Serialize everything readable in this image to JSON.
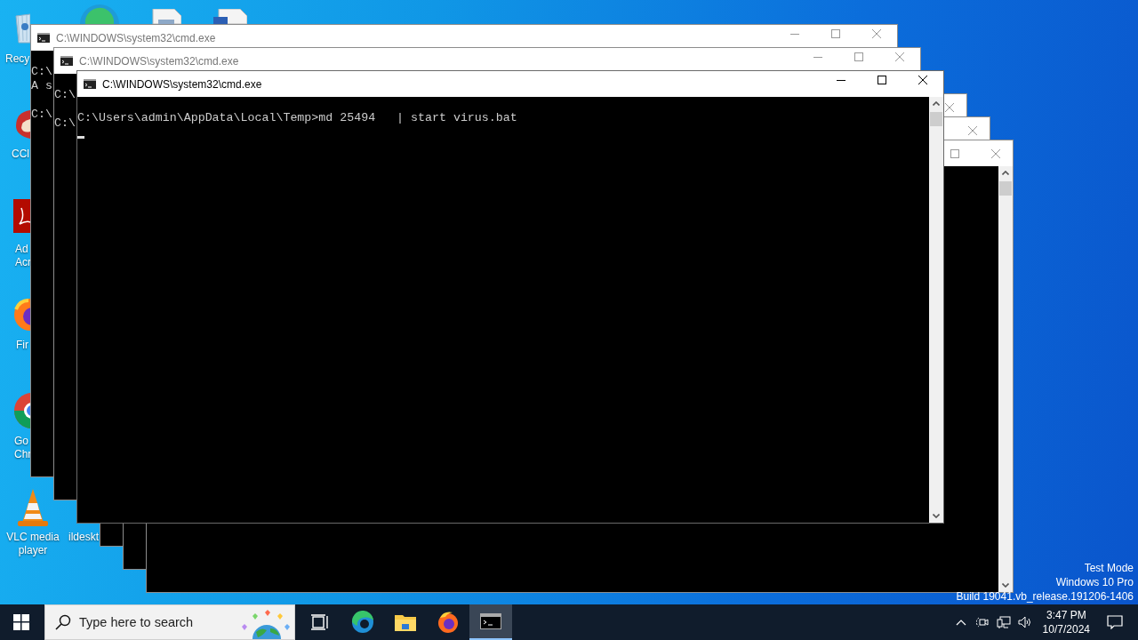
{
  "desktop_icons": [
    {
      "label": [
        "Recy"
      ]
    },
    {
      "label": [
        "CCl"
      ]
    },
    {
      "label": [
        "Ad",
        "Acr"
      ]
    },
    {
      "label": [
        "Fir"
      ]
    },
    {
      "label": [
        "Go",
        "Chr"
      ]
    },
    {
      "label": [
        "VLC media",
        "player"
      ]
    },
    {
      "label": [
        "ildeskt"
      ]
    }
  ],
  "windows": [
    {
      "title": "C:\\WINDOWS\\system32\\cmd.exe",
      "active": false,
      "controls": [
        {
          "kind": "minimize"
        },
        {
          "kind": "maximize"
        },
        {
          "kind": "close"
        }
      ],
      "blocks": [
        [
          "C:\\",
          "A s"
        ],
        [
          "C:\\"
        ]
      ]
    },
    {
      "title": "C:\\WINDOWS\\system32\\cmd.exe",
      "active": false,
      "controls": [
        {
          "kind": "minimize"
        },
        {
          "kind": "maximize"
        },
        {
          "kind": "close"
        }
      ],
      "blocks": [
        [
          "C:\\"
        ],
        [
          "C:\\"
        ]
      ]
    },
    {
      "title": "C:\\WINDOWS\\system32\\cmd.exe",
      "active": true,
      "controls": [
        {
          "kind": "minimize"
        },
        {
          "kind": "maximize"
        },
        {
          "kind": "close"
        }
      ],
      "scrollbar": true,
      "cursor": true,
      "blocks": [
        [
          "C:\\Users\\admin\\AppData\\Local\\Temp>md 25494   | start virus.bat"
        ]
      ]
    },
    {
      "active": false,
      "controls": [
        {
          "kind": "close"
        }
      ]
    },
    {
      "active": false,
      "controls": [
        {
          "kind": "close"
        }
      ]
    },
    {
      "active": false,
      "controls": [
        {
          "kind": "maximize"
        },
        {
          "kind": "close"
        }
      ],
      "scrollbar": true
    }
  ],
  "system_notice": [
    "Test Mode",
    "Windows 10 Pro",
    "Build 19041.vb_release.191206-1406"
  ],
  "taskbar": {
    "search": {
      "placeholder": "Type here to search"
    },
    "apps": [
      {
        "selected": false
      },
      {
        "selected": false
      },
      {
        "selected": false
      },
      {
        "selected": false
      },
      {
        "selected": true
      }
    ],
    "clock": {
      "time": "3:47 PM",
      "date": "10/7/2024"
    }
  }
}
